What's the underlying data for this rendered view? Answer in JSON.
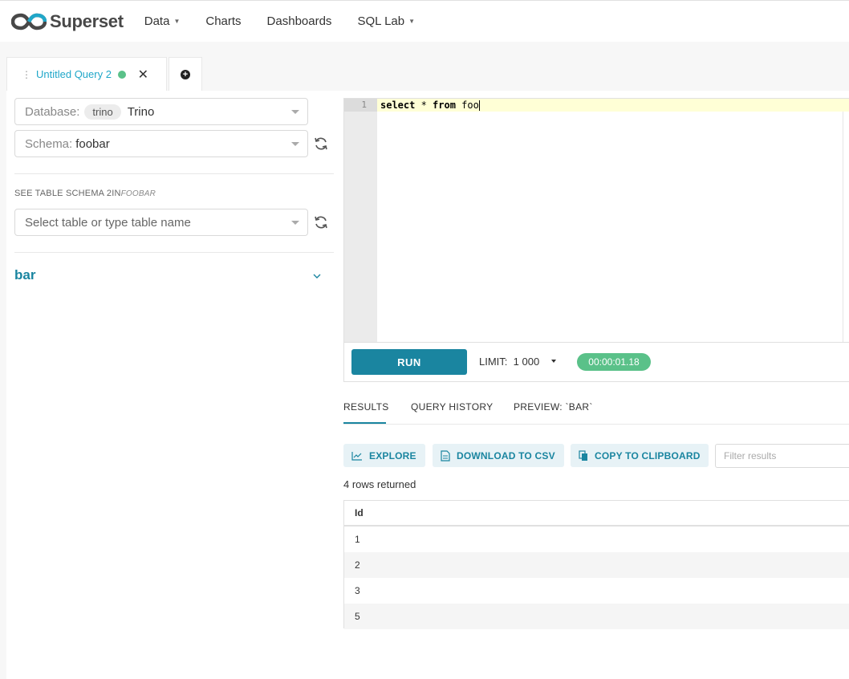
{
  "app": {
    "name": "Superset"
  },
  "nav": {
    "items": [
      {
        "label": "Data",
        "dropdown": true
      },
      {
        "label": "Charts",
        "dropdown": false
      },
      {
        "label": "Dashboards",
        "dropdown": false
      },
      {
        "label": "SQL Lab",
        "dropdown": true
      }
    ]
  },
  "tabs": {
    "active": {
      "label": "Untitled Query 2",
      "status_color": "#5ac189"
    }
  },
  "left": {
    "database": {
      "label": "Database:",
      "pill": "trino",
      "value": "Trino"
    },
    "schema": {
      "label": "Schema:",
      "value": "foobar"
    },
    "schema_title": {
      "prefix": "SEE TABLE SCHEMA",
      "count": "2",
      "in": "IN",
      "schema": "FOOBAR"
    },
    "table_select": {
      "placeholder": "Select table or type table name"
    },
    "table_name": "bar"
  },
  "editor": {
    "line_number": "1",
    "kw_select": "select",
    "star": " * ",
    "kw_from": "from",
    "table": " foo"
  },
  "toolbar": {
    "run": "RUN",
    "limit_label": "LIMIT:",
    "limit_value": "1 000",
    "timer": "00:00:01.18"
  },
  "results": {
    "tabs": [
      "RESULTS",
      "QUERY HISTORY",
      "PREVIEW: `BAR`"
    ],
    "explore": "EXPLORE",
    "download": "DOWNLOAD TO CSV",
    "copy": "COPY TO CLIPBOARD",
    "filter_placeholder": "Filter results",
    "row_count": "4 rows returned",
    "columns": [
      "Id"
    ],
    "rows": [
      "1",
      "2",
      "3",
      "5"
    ]
  },
  "colors": {
    "brand": "#1a85a0",
    "success": "#5ac189",
    "link": "#20a7c9"
  }
}
